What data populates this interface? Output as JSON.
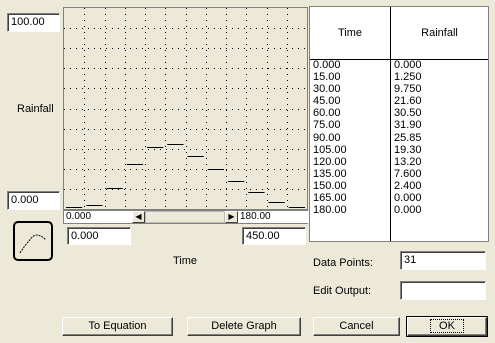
{
  "graph": {
    "y_max": "100.00",
    "y_min": "0.000",
    "y_label": "Rainfall",
    "x_label": "Time",
    "x_min_field": "0.000",
    "x_max_field": "450.00",
    "scroll_left_value": "0.000",
    "scroll_right_value": "180.00"
  },
  "chart_data": {
    "type": "line",
    "x": [
      0,
      15,
      30,
      45,
      60,
      75,
      90,
      105,
      120,
      135,
      150,
      165,
      180
    ],
    "series": [
      {
        "values": [
          0.0,
          1.25,
          9.75,
          21.6,
          30.5,
          31.9,
          25.85,
          19.3,
          13.2,
          7.6,
          2.4,
          0.0,
          0.0
        ]
      }
    ],
    "xlim": [
      0,
      180
    ],
    "ylim": [
      0,
      100
    ],
    "grid": true
  },
  "table": {
    "headers": {
      "time": "Time",
      "rainfall": "Rainfall"
    },
    "time": [
      "0.000",
      "15.00",
      "30.00",
      "45.00",
      "60.00",
      "75.00",
      "90.00",
      "105.00",
      "120.00",
      "135.00",
      "150.00",
      "165.00",
      "180.00"
    ],
    "rainfall": [
      "0.000",
      "1.250",
      "9.750",
      "21.60",
      "30.50",
      "31.90",
      "25.85",
      "19.30",
      "13.20",
      "7.600",
      "2.400",
      "0.000",
      "0.000"
    ]
  },
  "form": {
    "data_points_label": "Data Points:",
    "data_points_value": "31",
    "edit_output_label": "Edit Output:",
    "edit_output_value": ""
  },
  "buttons": {
    "to_equation": "To Equation",
    "delete_graph": "Delete Graph",
    "cancel": "Cancel",
    "ok": "OK"
  },
  "icons": {
    "curve": "curve-icon",
    "scroll_left": "arrow-left-icon",
    "scroll_right": "arrow-right-icon"
  }
}
